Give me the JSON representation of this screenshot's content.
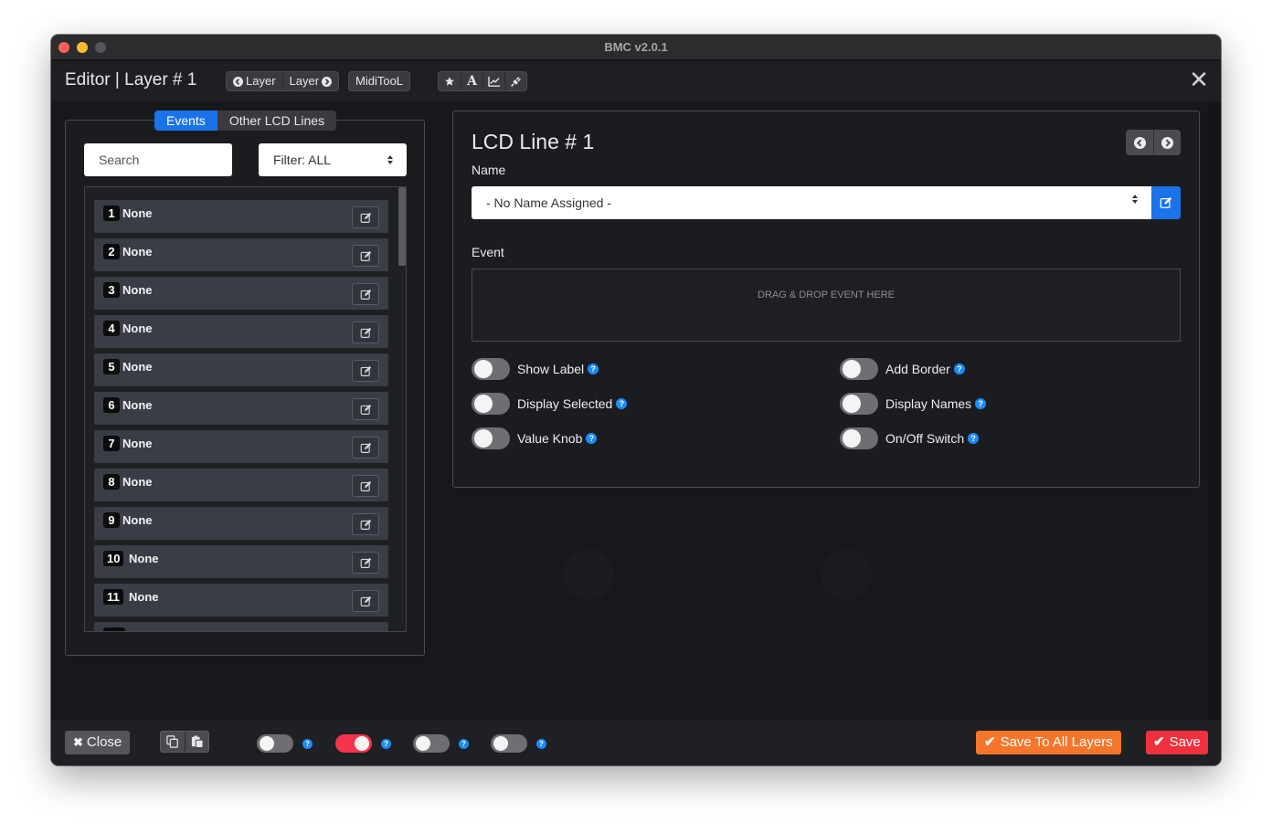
{
  "window": {
    "title": "BMC v2.0.1"
  },
  "topbar": {
    "title": "Editor | Layer # 1",
    "layer_prev_label": "Layer",
    "layer_next_label": "Layer",
    "miditool_label": "MidiTooL",
    "tool_icons": [
      "star-icon",
      "font-icon",
      "line-chart-icon",
      "plug-icon"
    ]
  },
  "left_panel": {
    "tabs": [
      {
        "label": "Events",
        "active": true
      },
      {
        "label": "Other LCD Lines",
        "active": false
      }
    ],
    "search_placeholder": "Search",
    "filter_label": "Filter: ALL",
    "items": [
      {
        "num": "1",
        "label": "None"
      },
      {
        "num": "2",
        "label": "None"
      },
      {
        "num": "3",
        "label": "None"
      },
      {
        "num": "4",
        "label": "None"
      },
      {
        "num": "5",
        "label": "None"
      },
      {
        "num": "6",
        "label": "None"
      },
      {
        "num": "7",
        "label": "None"
      },
      {
        "num": "8",
        "label": "None"
      },
      {
        "num": "9",
        "label": "None"
      },
      {
        "num": "10",
        "label": "None"
      },
      {
        "num": "11",
        "label": "None"
      }
    ]
  },
  "right_panel": {
    "title": "LCD Line # 1",
    "name_label": "Name",
    "name_value": "- No Name Assigned -",
    "event_label": "Event",
    "drop_text": "DRAG & DROP EVENT HERE",
    "toggles": [
      {
        "label": "Show Label",
        "on": false
      },
      {
        "label": "Display Selected",
        "on": false
      },
      {
        "label": "Value Knob",
        "on": false
      },
      {
        "label": "Add Border",
        "on": false
      },
      {
        "label": "Display Names",
        "on": false
      },
      {
        "label": "On/Off Switch",
        "on": false
      }
    ]
  },
  "bottombar": {
    "close_label": "Close",
    "toggles": [
      {
        "on": false
      },
      {
        "on": true
      },
      {
        "on": false
      },
      {
        "on": false
      }
    ],
    "save_all_label": "Save To All Layers",
    "save_label": "Save"
  },
  "colors": {
    "accent_blue": "#1a73e8",
    "toggle_on": "#f5344c",
    "save_all": "#f5762a",
    "save": "#f0303d"
  }
}
